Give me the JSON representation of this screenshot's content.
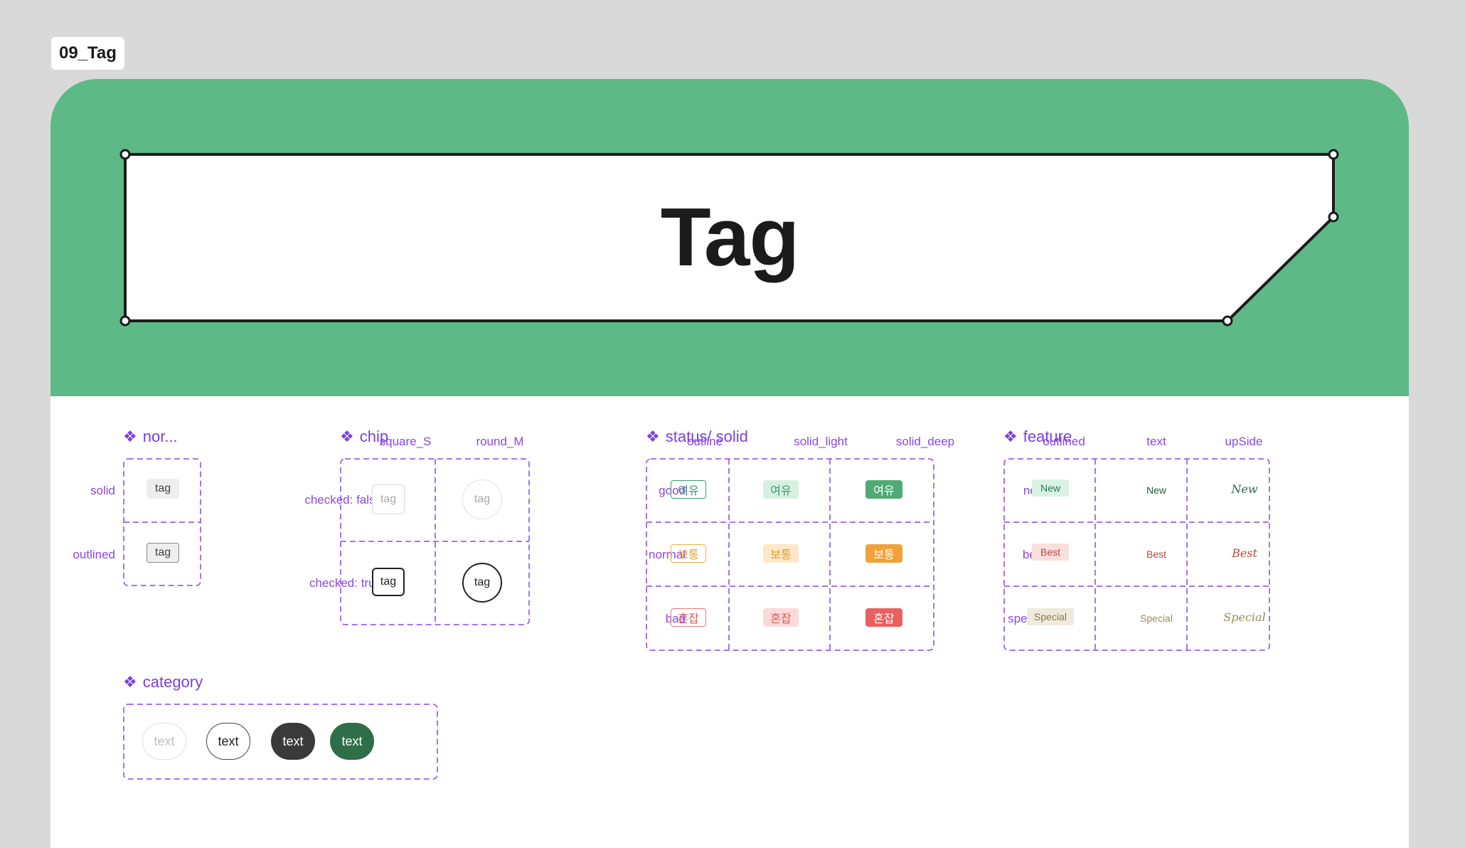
{
  "frame_label": "09_Tag",
  "hero": {
    "title": "Tag",
    "background": "#5dba86"
  },
  "sections": {
    "normal": {
      "heading": "nor...",
      "rows": [
        "solid",
        "outlined"
      ],
      "tag_text": "tag"
    },
    "chip": {
      "heading": "chip",
      "columns": [
        "square_S",
        "round_M"
      ],
      "rows": [
        "checked: false",
        "checked: true"
      ],
      "tag_text": "tag"
    },
    "status": {
      "heading": "status/ solid",
      "columns": [
        "outline",
        "solid_light",
        "solid_deep"
      ],
      "rows": [
        "good",
        "normal",
        "bad"
      ],
      "values": [
        "여유",
        "보통",
        "혼잡"
      ]
    },
    "feature": {
      "heading": "feature",
      "columns": [
        "outlined",
        "text",
        "upSide"
      ],
      "rows": [
        "new",
        "best",
        "special"
      ],
      "values": [
        "New",
        "Best",
        "Special"
      ]
    },
    "category": {
      "heading": "category",
      "items": [
        "text",
        "text",
        "text",
        "text"
      ]
    }
  },
  "colors": {
    "guide_purple": "#8a46e8",
    "good": "#3a9b6a",
    "normal": "#f0a23a",
    "bad": "#e35a5a",
    "feature_new": "#2a7a52",
    "feature_best": "#c0463c",
    "feature_special": "#9a8a5a",
    "category_dark": "#3a3a3a",
    "category_green": "#2e6e48"
  }
}
